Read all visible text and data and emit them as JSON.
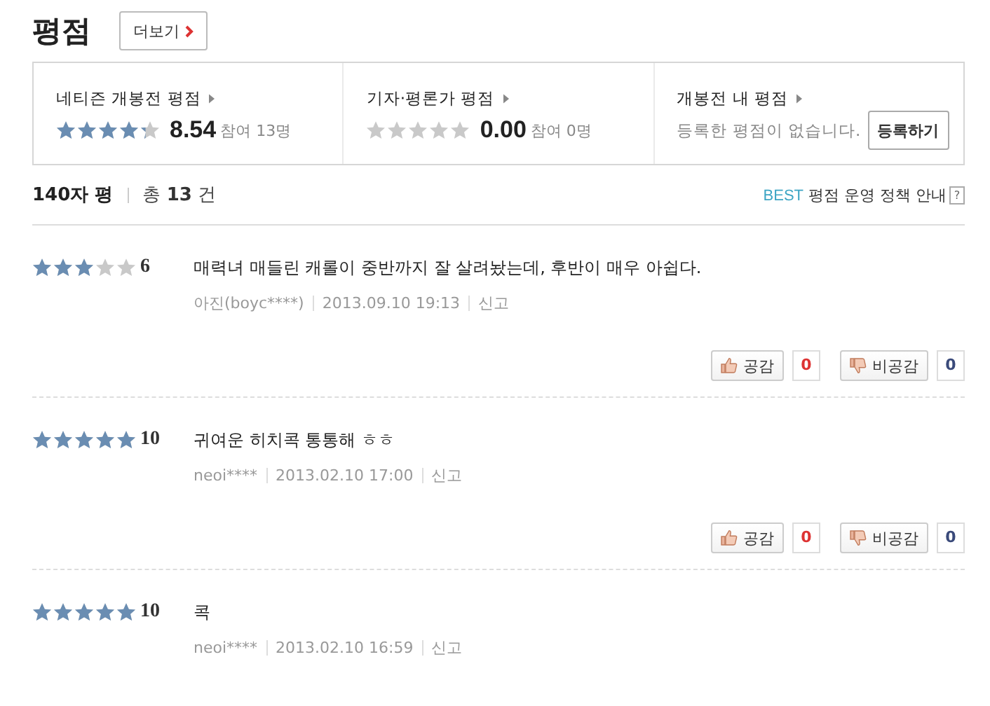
{
  "header": {
    "title": "평점",
    "more_button": "더보기"
  },
  "summary": [
    {
      "kind": "score",
      "label": "네티즌 개봉전 평점",
      "stars": 4.27,
      "score": "8.54",
      "participants": "참여 13명"
    },
    {
      "kind": "score",
      "label": "기자·평론가 평점",
      "stars": 0,
      "score": "0.00",
      "participants": "참여 0명"
    },
    {
      "kind": "mine",
      "label": "개봉전 내 평점",
      "message": "등록한 평점이 없습니다.",
      "button": "등록하기"
    }
  ],
  "list_header": {
    "title": "140자 평",
    "total_label": "총",
    "total": "13",
    "unit": "건",
    "policy_badge": "BEST",
    "policy": "평점 운영 정책 안내",
    "help": "?"
  },
  "reviews": [
    {
      "stars": 3,
      "score": "6",
      "text": "매력녀 매들린 캐롤이 중반까지 잘 살려놨는데, 후반이 매우 아쉽다.",
      "author": "아진(boyc****)",
      "date": "2013.09.10 19:13",
      "report": "신고",
      "votes": {
        "like_label": "공감",
        "like": "0",
        "dislike_label": "비공감",
        "dislike": "0"
      }
    },
    {
      "stars": 5,
      "score": "10",
      "text": "귀여운 히치콕 통통해 ㅎㅎ",
      "author": "neoi****",
      "date": "2013.02.10 17:00",
      "report": "신고",
      "votes": {
        "like_label": "공감",
        "like": "0",
        "dislike_label": "비공감",
        "dislike": "0"
      }
    },
    {
      "stars": 5,
      "score": "10",
      "text": "콕",
      "author": "neoi****",
      "date": "2013.02.10 16:59",
      "report": "신고"
    }
  ]
}
